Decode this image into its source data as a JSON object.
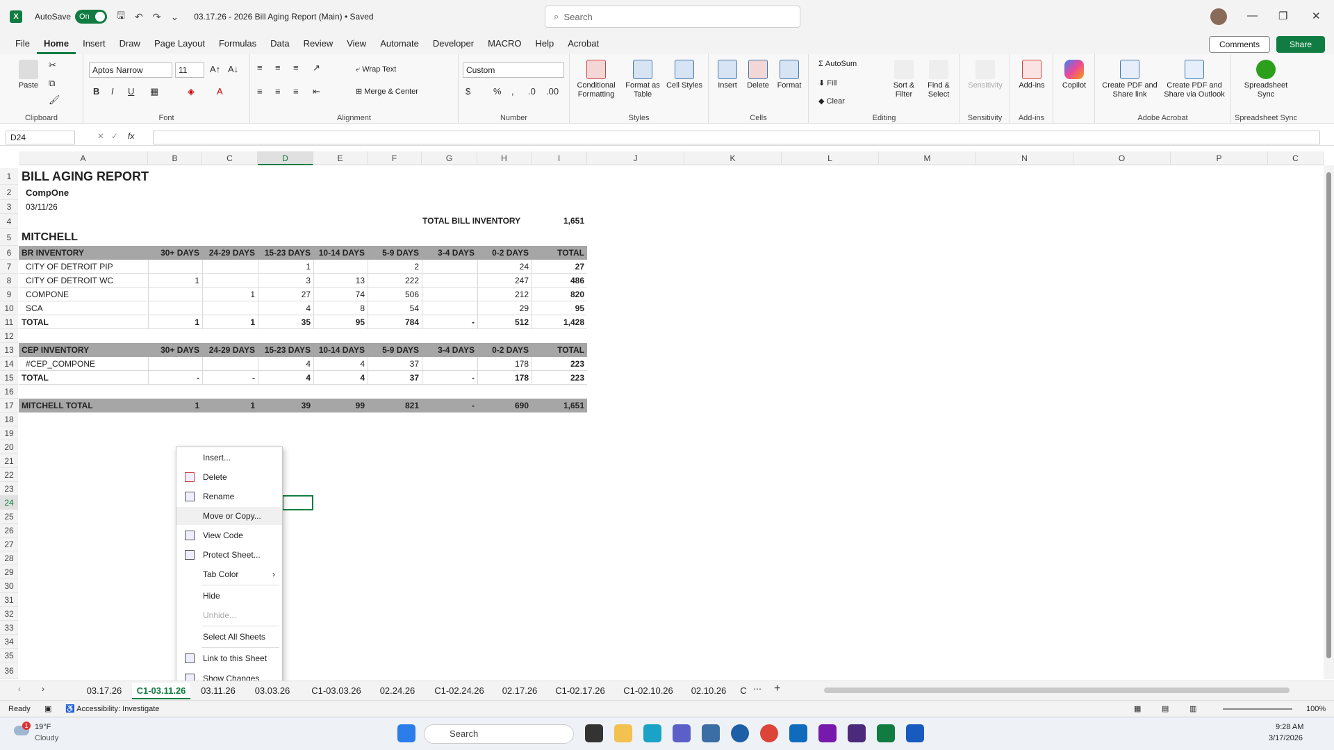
{
  "titlebar": {
    "app": "X",
    "autosave": "AutoSave",
    "toggle": "On",
    "doc": "03.17.26 - 2026 Bill Aging Report (Main)  •  Saved",
    "search": "Search"
  },
  "menu": [
    "File",
    "Home",
    "Insert",
    "Draw",
    "Page Layout",
    "Formulas",
    "Data",
    "Review",
    "View",
    "Automate",
    "Developer",
    "MACRO",
    "Help",
    "Acrobat"
  ],
  "buttons": {
    "comments": "Comments",
    "share": "Share"
  },
  "ribbon": {
    "font_name": "Aptos Narrow",
    "font_size": "11",
    "number_format": "Custom",
    "wrap": "Wrap Text",
    "merge": "Merge & Center",
    "autosum": "AutoSum",
    "fill": "Fill",
    "clear": "Clear",
    "groups": {
      "clipboard": "Clipboard",
      "font": "Font",
      "alignment": "Alignment",
      "number": "Number",
      "styles": "Styles",
      "cells": "Cells",
      "editing": "Editing",
      "sensitivity": "Sensitivity",
      "addins": "Add-ins",
      "acrobat": "Adobe Acrobat",
      "sync": "Spreadsheet Sync"
    },
    "big": {
      "paste": "Paste",
      "cond": "Conditional Formatting",
      "fmt_table": "Format as Table",
      "cell_styles": "Cell Styles",
      "insert": "Insert",
      "delete": "Delete",
      "format": "Format",
      "sort": "Sort & Filter",
      "find": "Find & Select",
      "sens": "Sensitivity",
      "addins": "Add-ins",
      "copilot": "Copilot",
      "pdf1": "Create PDF and Share link",
      "pdf2": "Create PDF and Share via Outlook",
      "sync": "Spreadsheet Sync"
    }
  },
  "formula": {
    "namebox": "D24",
    "fx": "fx"
  },
  "columns": [
    "A",
    "B",
    "C",
    "D",
    "E",
    "F",
    "G",
    "H",
    "I",
    "J",
    "K",
    "L",
    "M",
    "N",
    "O",
    "P",
    "C"
  ],
  "rows": [
    "1",
    "2",
    "3",
    "4",
    "5",
    "6",
    "7",
    "8",
    "9",
    "10",
    "11",
    "12",
    "13",
    "14",
    "15",
    "16",
    "17",
    "18",
    "19",
    "20",
    "21",
    "22",
    "23",
    "24",
    "25",
    "26",
    "27",
    "28",
    "29",
    "30",
    "31",
    "32",
    "33",
    "34",
    "35",
    "36"
  ],
  "sheet": {
    "title": "BILL AGING REPORT",
    "company": "CompOne",
    "date": "03/11/26",
    "total_label": "TOTAL BILL INVENTORY",
    "total_value": "1,651",
    "section": "MITCHELL",
    "headers": [
      "30+ DAYS",
      "24-29 DAYS",
      "15-23 DAYS",
      "10-14 DAYS",
      "5-9 DAYS",
      "3-4 DAYS",
      "0-2 DAYS",
      "TOTAL"
    ],
    "br_label": "BR INVENTORY",
    "br_rows": [
      {
        "name": "CITY OF DETROIT PIP",
        "v": [
          "",
          "",
          "1",
          "",
          "2",
          "",
          "24",
          "27"
        ]
      },
      {
        "name": "CITY OF DETROIT WC",
        "v": [
          "1",
          "",
          "3",
          "13",
          "222",
          "",
          "247",
          "486"
        ]
      },
      {
        "name": "COMPONE",
        "v": [
          "",
          "1",
          "27",
          "74",
          "506",
          "",
          "212",
          "820"
        ]
      },
      {
        "name": "SCA",
        "v": [
          "",
          "",
          "4",
          "8",
          "54",
          "",
          "29",
          "95"
        ]
      }
    ],
    "br_total": {
      "name": "TOTAL",
      "v": [
        "1",
        "1",
        "35",
        "95",
        "784",
        "-",
        "512",
        "1,428"
      ]
    },
    "cep_label": "CEP INVENTORY",
    "cep_rows": [
      {
        "name": "#CEP_COMPONE",
        "v": [
          "",
          "",
          "4",
          "4",
          "37",
          "",
          "178",
          "223"
        ]
      }
    ],
    "cep_total": {
      "name": "TOTAL",
      "v": [
        "-",
        "-",
        "4",
        "4",
        "37",
        "-",
        "178",
        "223"
      ]
    },
    "grand": {
      "name": "MITCHELL TOTAL",
      "v": [
        "1",
        "1",
        "39",
        "99",
        "821",
        "-",
        "690",
        "1,651"
      ]
    }
  },
  "context_menu": [
    "Insert...",
    "Delete",
    "Rename",
    "Move or Copy...",
    "View Code",
    "Protect Sheet...",
    "Tab Color",
    "Hide",
    "Unhide...",
    "Select All Sheets",
    "Link to this Sheet",
    "Show Changes"
  ],
  "tabs": [
    "03.17.26",
    "C1-03.11.26",
    "03.11.26",
    "03.03.26",
    "C1-03.03.26",
    "02.24.26",
    "C1-02.24.26",
    "02.17.26",
    "C1-02.17.26",
    "C1-02.10.26",
    "02.10.26",
    "C"
  ],
  "status": {
    "ready": "Ready",
    "access": "Accessibility: Investigate",
    "zoom": "100%"
  },
  "taskbar": {
    "temp": "19°F",
    "weather": "Cloudy",
    "badge": "1",
    "search": "Search",
    "time": "9:28 AM",
    "date": "3/17/2026"
  }
}
